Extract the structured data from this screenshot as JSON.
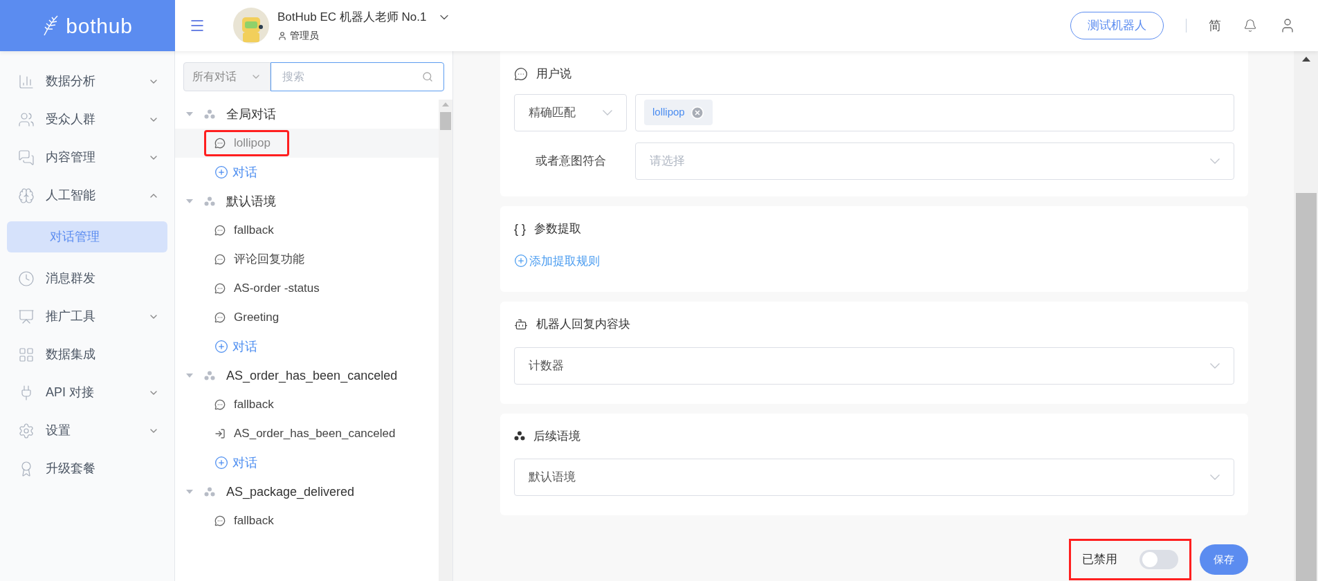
{
  "header": {
    "logo": "bothub",
    "bot_name": "BotHub EC 机器人老师 No.1",
    "role": "管理员",
    "test_button": "测试机器人",
    "language": "简"
  },
  "sidebar": {
    "items": [
      {
        "label": "数据分析",
        "kind": "group",
        "expanded": false
      },
      {
        "label": "受众人群",
        "kind": "group",
        "expanded": false
      },
      {
        "label": "内容管理",
        "kind": "group",
        "expanded": false
      },
      {
        "label": "人工智能",
        "kind": "group",
        "expanded": true,
        "children": [
          {
            "label": "对话管理",
            "selected": true
          }
        ]
      },
      {
        "label": "消息群发",
        "kind": "link"
      },
      {
        "label": "推广工具",
        "kind": "group",
        "expanded": false
      },
      {
        "label": "数据集成",
        "kind": "link"
      },
      {
        "label": "API 对接",
        "kind": "group",
        "expanded": false
      },
      {
        "label": "设置",
        "kind": "group",
        "expanded": false
      },
      {
        "label": "升级套餐",
        "kind": "link"
      }
    ]
  },
  "tree": {
    "filter": "所有对话",
    "search_placeholder": "搜索",
    "contexts": [
      {
        "name": "全局对话",
        "expanded": true,
        "add_label": "对话",
        "children": [
          {
            "label": "lollipop",
            "kind": "dialog",
            "selected": true,
            "annotated": true
          }
        ]
      },
      {
        "name": "默认语境",
        "expanded": true,
        "add_label": "对话",
        "children": [
          {
            "label": "fallback",
            "kind": "dialog",
            "selected": false,
            "annotated": false
          },
          {
            "label": "评论回复功能",
            "kind": "dialog",
            "selected": false,
            "annotated": false
          },
          {
            "label": "AS-order -status",
            "kind": "dialog",
            "selected": false,
            "annotated": false
          },
          {
            "label": "Greeting",
            "kind": "dialog",
            "selected": false,
            "annotated": false
          }
        ]
      },
      {
        "name": "AS_order_has_been_canceled",
        "expanded": true,
        "add_label": "对话",
        "children": [
          {
            "label": "fallback",
            "kind": "dialog",
            "selected": false,
            "annotated": false
          },
          {
            "label": "AS_order_has_been_canceled",
            "kind": "exit",
            "selected": false,
            "annotated": false
          }
        ]
      },
      {
        "name": "AS_package_delivered",
        "expanded": true,
        "children": [
          {
            "label": "fallback",
            "kind": "dialog",
            "selected": false,
            "annotated": false
          }
        ]
      }
    ]
  },
  "user_says": {
    "title": "用户说",
    "match_type": "精确匹配",
    "tags": [
      "lollipop"
    ],
    "intent_label": "或者意图符合",
    "intent_placeholder": "请选择"
  },
  "params": {
    "title": "参数提取",
    "icon_text": "{ }",
    "add_link": "添加提取规则"
  },
  "reply": {
    "title": "机器人回复内容块",
    "value": "计数器"
  },
  "next_context": {
    "title": "后续语境",
    "value": "默认语境"
  },
  "footer": {
    "toggle_label": "已禁用",
    "on": false,
    "annotated": true,
    "save": "保存"
  }
}
